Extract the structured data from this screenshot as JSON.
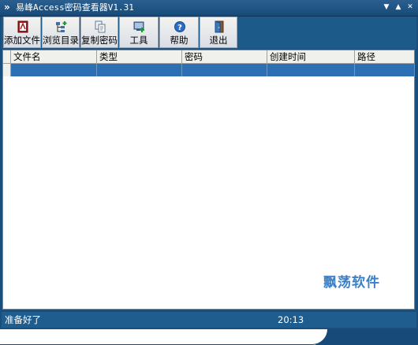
{
  "window": {
    "title": "易峰Access密码查看器V1.31"
  },
  "toolbar": {
    "buttons": [
      {
        "label": "添加文件",
        "icon": "add-file-icon"
      },
      {
        "label": "浏览目录",
        "icon": "browse-folder-icon"
      },
      {
        "label": "复制密码",
        "icon": "copy-password-icon"
      },
      {
        "label": "工具",
        "icon": "tools-icon"
      },
      {
        "label": "帮助",
        "icon": "help-icon"
      },
      {
        "label": "退出",
        "icon": "exit-icon"
      }
    ]
  },
  "table": {
    "columns": [
      "文件名",
      "类型",
      "密码",
      "创建时间",
      "路径"
    ],
    "rows": [
      [
        "",
        "",
        "",
        "",
        ""
      ]
    ]
  },
  "watermark": "飘荡软件",
  "status": {
    "text": "准备好了",
    "time": "20:13"
  },
  "colors": {
    "titlebar": "#174a78",
    "selected_row": "#2c6fb4",
    "watermark": "#3a7fc7"
  }
}
